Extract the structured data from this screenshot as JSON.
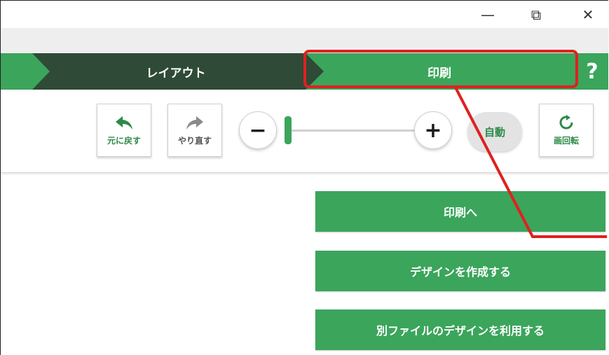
{
  "window": {
    "controls": {
      "minimize": "—",
      "restore": "⧉",
      "close": "✕"
    }
  },
  "steps": {
    "layout_label": "レイアウト",
    "print_label": "印刷",
    "help_label": "?"
  },
  "toolbar": {
    "undo_label": "元に戻す",
    "redo_label": "やり直す",
    "zoom_out_label": "−",
    "zoom_in_label": "+",
    "zoom_level": 0.05,
    "auto_label": "自動",
    "rotate_label": "画回転"
  },
  "actions": {
    "to_print": "印刷へ",
    "create_design": "デザインを作成する",
    "use_other_file": "別ファイルのデザインを利用する"
  },
  "colors": {
    "accent_green": "#3ba55c",
    "dark_green": "#2f4a36",
    "highlight_red": "#e02020"
  },
  "icons": [
    "undo-arrow-icon",
    "redo-arrow-icon",
    "rotate-icon",
    "help-icon"
  ]
}
